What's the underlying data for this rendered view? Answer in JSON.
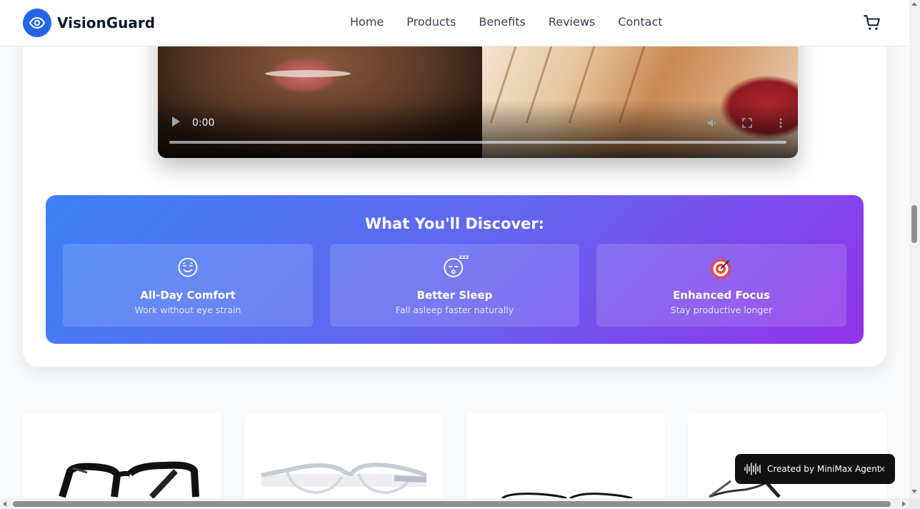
{
  "header": {
    "brand": "VisionGuard",
    "nav": [
      "Home",
      "Products",
      "Benefits",
      "Reviews",
      "Contact"
    ],
    "logo_icon": "eye-icon",
    "cart_icon": "cart-icon",
    "accent_color": "#2563eb"
  },
  "video": {
    "time": "0:00",
    "progress": 0,
    "controls": [
      "play-icon",
      "volume-icon",
      "fullscreen-icon",
      "more-options-icon"
    ]
  },
  "discover": {
    "title": "What You'll Discover:",
    "features": [
      {
        "icon": "relieved-face-icon",
        "title": "All-Day Comfort",
        "desc": "Work without eye strain"
      },
      {
        "icon": "sleeping-face-icon",
        "title": "Better Sleep",
        "desc": "Fall asleep faster naturally"
      },
      {
        "icon": "target-icon",
        "title": "Enhanced Focus",
        "desc": "Stay productive longer"
      }
    ],
    "gradient": [
      "#3b82f6",
      "#6366f1",
      "#9333ea"
    ]
  },
  "products": [
    {
      "image": "black-frame-glasses"
    },
    {
      "image": "clear-frame-glasses"
    },
    {
      "image": "thin-black-glasses"
    },
    {
      "image": "metal-frame-glasses"
    }
  ],
  "toast": {
    "text": "Created by MiniMax Agent",
    "close": "×",
    "icon": "minimax-waveform-icon"
  }
}
